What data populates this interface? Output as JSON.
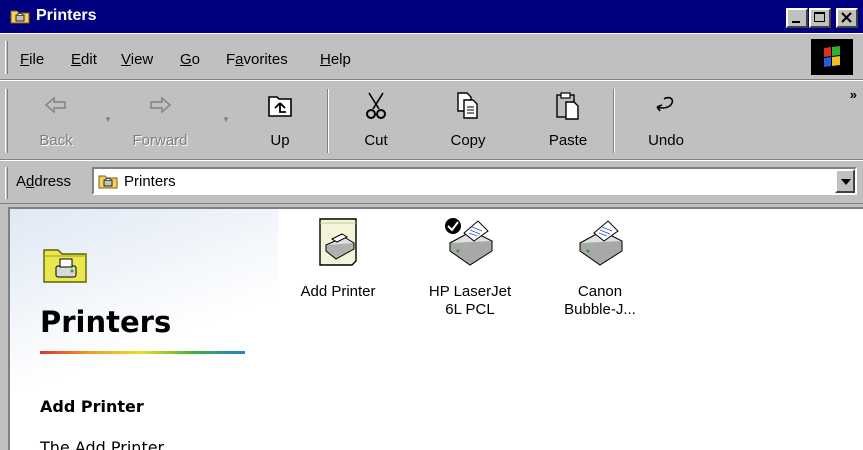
{
  "window": {
    "title": "Printers"
  },
  "menu": {
    "items": [
      {
        "pre": "",
        "key": "F",
        "post": "ile"
      },
      {
        "pre": "",
        "key": "E",
        "post": "dit"
      },
      {
        "pre": "",
        "key": "V",
        "post": "iew"
      },
      {
        "pre": "",
        "key": "G",
        "post": "o"
      },
      {
        "pre": "F",
        "key": "a",
        "post": "vorites"
      },
      {
        "pre": "",
        "key": "H",
        "post": "elp"
      }
    ]
  },
  "toolbar": {
    "back": "Back",
    "forward": "Forward",
    "up": "Up",
    "cut": "Cut",
    "copy": "Copy",
    "paste": "Paste",
    "undo": "Undo",
    "more": "»"
  },
  "address": {
    "label_pre": "A",
    "label_key": "d",
    "label_post": "dress",
    "value": "Printers"
  },
  "leftpane": {
    "title": "Printers",
    "subtitle": "Add Printer",
    "description": "The Add Printer"
  },
  "items": [
    {
      "line1": "Add Printer",
      "line2": ""
    },
    {
      "line1": "HP LaserJet",
      "line2": "6L PCL",
      "default": true
    },
    {
      "line1": "Canon",
      "line2": "Bubble-J..."
    }
  ],
  "colors": {
    "titlebar": "#000080",
    "face": "#c0c0c0"
  }
}
